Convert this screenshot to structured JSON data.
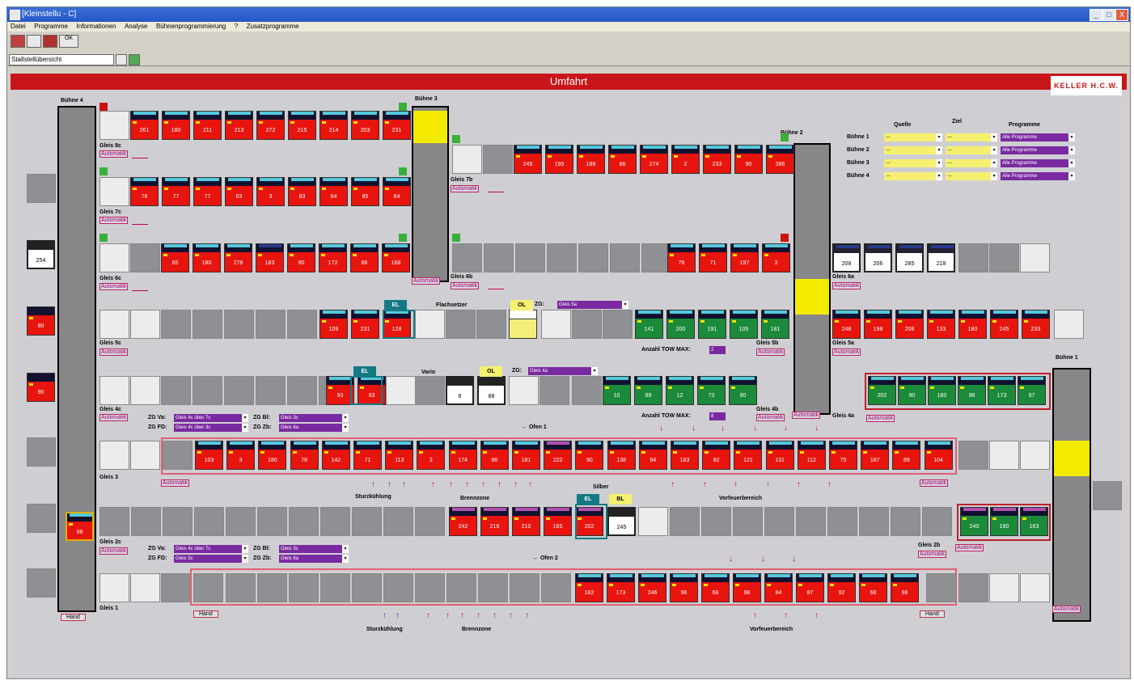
{
  "window": {
    "title": "[Kleinstellu - C]",
    "min": "_",
    "max": "□",
    "close": "X"
  },
  "menu": [
    "Datei",
    "Programme",
    "Informationen",
    "Analyse",
    "Bühnenprogrammierung",
    "?",
    "Zusatzprogramme"
  ],
  "toolbar": {
    "ok_label": "OK",
    "view_select": "Stallstellübersicht"
  },
  "header": {
    "title": "Umfahrt",
    "brand": "KELLER H.C.W."
  },
  "bahnen": {
    "b4": "Bühne 4",
    "b3": "Bühne 3",
    "b2": "Bühne 2",
    "b1": "Bühne 1"
  },
  "routing": {
    "col_quelle": "Quelle",
    "col_ziel": "Ziel",
    "col_programme": "Programme",
    "rows": [
      {
        "label": "Bühne 1",
        "quelle": "---",
        "ziel": "---",
        "programme": "Alle Programme"
      },
      {
        "label": "Bühne 2",
        "quelle": "---",
        "ziel": "---",
        "programme": "Alle Programme"
      },
      {
        "label": "Bühne 3",
        "quelle": "---",
        "ziel": "---",
        "programme": "Alle Programme"
      },
      {
        "label": "Bühne 4",
        "quelle": "---",
        "ziel": "---",
        "programme": "Alle Programme"
      }
    ]
  },
  "labels": {
    "gleis8c": "Gleis 8c",
    "gleis7c": "Gleis 7c",
    "gleis7b": "Gleis 7b",
    "gleis6c": "Gleis 6c",
    "gleis6b": "Gleis 6b",
    "gleis6a": "Gleis 6a",
    "gleis5c": "Gleis 5c",
    "gleis5b": "Gleis 5b",
    "gleis5a": "Gleis 5a",
    "gleis4c": "Gleis 4c",
    "gleis4b": "Gleis 4b",
    "gleis4a": "Gleis 4a",
    "gleis3": "Gleis 3",
    "gleis2c": "Gleis 2c",
    "gleis2b": "Gleis 2b",
    "gleis1": "Gleis 1",
    "automatik": "Automatik",
    "hand": "Hand",
    "flachsetzer": "Flachsetzer",
    "vario": "Vario",
    "zg": "ZG:",
    "zg_gleis5a": "Gleis 5a",
    "zg_gleis4a": "Gleis 4a",
    "anzahl5": "Anzahl TOW MAX:",
    "anzahl5_val": "2",
    "anzahl4": "Anzahl TOW MAX:",
    "anzahl4_val": "8",
    "zgva": "ZG Va:",
    "zgfd": "ZG FD:",
    "zgbl": "ZG Bl:",
    "zgzb": "ZG Zb:",
    "dd_va4": "Gleis 4c über 7c",
    "dd_fd4": "Gleis 4c über 3c",
    "dd_bl4": "Gleis 3c",
    "dd_zb4": "Gleis 6a",
    "dd_va2": "Gleis 4c über 7c",
    "dd_fd2": "Gleis 5c",
    "dd_bl2": "Gleis 3c",
    "dd_zb2": "Gleis 6a",
    "ofen1": "←  Ofen 1",
    "ofen2": "←  Ofen 2",
    "steckuehlung": "Sturzkühlung",
    "brennzone": "Brennzone",
    "vorfeuer": "Vorfeuerbereich",
    "brennzone2": "Brennzone",
    "vorfeuer2": "Vorfeuerbereich",
    "steck2": "Sturzkühlung",
    "silber": "Silber",
    "tag_ol": "OL",
    "tag_el": "EL",
    "tag_ol2": "OL",
    "tag_el2": "EL",
    "tag_bl": "BL",
    "tag_el3": "EL",
    "tag_bl3": "BL"
  },
  "cars": {
    "r8c": [
      "261",
      "180",
      "211",
      "213",
      "272",
      "215",
      "214",
      "203",
      "231"
    ],
    "r7b": [
      "245",
      "195",
      "188",
      "86",
      "274",
      "2",
      "233",
      "90",
      "286"
    ],
    "r7c": [
      "76",
      "77",
      "77",
      "63",
      "3",
      "83",
      "64",
      "85",
      "64"
    ],
    "r6c": [
      "65",
      "180",
      "278",
      "183",
      "90",
      "172",
      "86",
      "168"
    ],
    "r6b": [
      "76",
      "71",
      "197",
      "3"
    ],
    "r6a": [
      "208",
      "206",
      "285",
      "218"
    ],
    "left6": "254",
    "r5c": [
      "109",
      "231",
      "128"
    ],
    "r5b": [
      "141",
      "200",
      "191",
      "105",
      "181"
    ],
    "r5a": [
      "248",
      "198",
      "208",
      "133",
      "180",
      "245",
      "233"
    ],
    "left5": "80",
    "r4c": [
      "93",
      "93"
    ],
    "r4b": [
      "10",
      "89",
      "12",
      "73",
      "90"
    ],
    "r4a": [
      "202",
      "90",
      "180",
      "98",
      "173",
      "97"
    ],
    "left4": "90",
    "r4w": [
      "8",
      "88"
    ],
    "r5w": "",
    "r3": [
      "103",
      "3",
      "180",
      "78",
      "142",
      "71",
      "113",
      "2",
      "174",
      "98",
      "181",
      "222",
      "90",
      "138",
      "94",
      "183",
      "82",
      "121",
      "131",
      "112",
      "75",
      "187",
      "89",
      "104"
    ],
    "r2": [
      "242",
      "216",
      "210",
      "165",
      "202"
    ],
    "r2w": "245",
    "r2b": [
      "240",
      "180",
      "163"
    ],
    "left2": "88",
    "r1": [
      "182",
      "173",
      "246",
      "96",
      "68",
      "98",
      "84",
      "87",
      "92",
      "68",
      "98"
    ]
  }
}
